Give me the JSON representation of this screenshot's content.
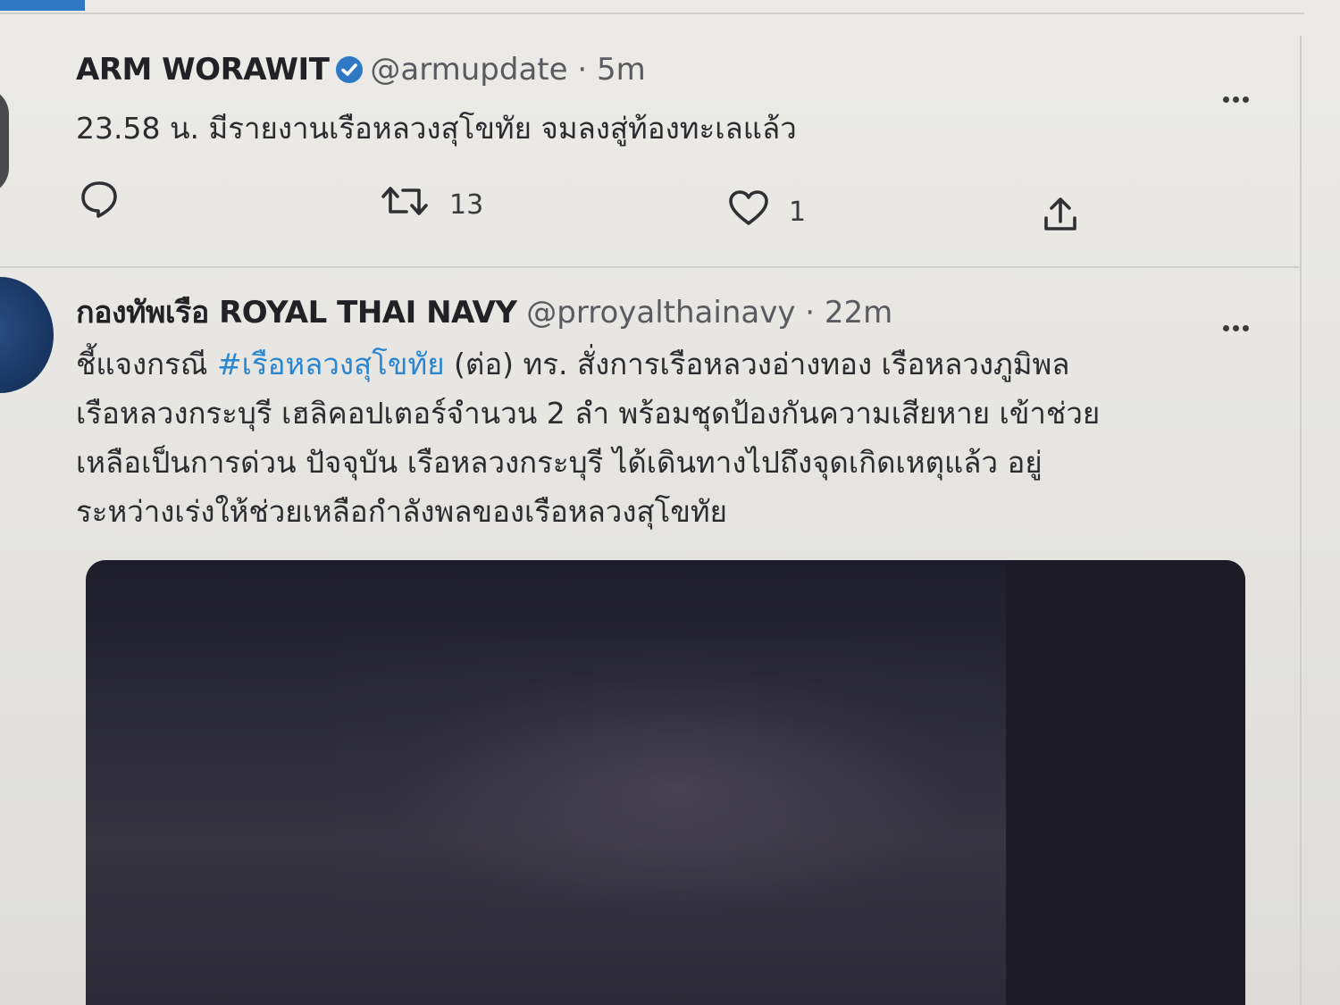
{
  "tweets": [
    {
      "author_name": "ARM WORAWIT",
      "handle": "@armupdate",
      "separator": "·",
      "time": "5m",
      "verified": true,
      "text_lines": [
        "23.58 น. มีรายงานเรือหลวงสุโขทัย จมลงสู่ท้องทะเลแล้ว"
      ],
      "reply_count": "",
      "retweet_count": "13",
      "like_count": "1"
    },
    {
      "author_name": "กองทัพเรือ ROYAL THAI NAVY",
      "handle": "@prroyalthainavy",
      "separator": "·",
      "time": "22m",
      "text_line1_prefix": "ชี้แจงกรณี ",
      "hashtag": "#เรือหลวงสุโขทัย",
      "text_line1_suffix": " (ต่อ) ทร. สั่งการเรือหลวงอ่างทอง เรือหลวงภูมิพล",
      "text_line2": "เรือหลวงกระบุรี เฮลิคอปเตอร์จำนวน 2 ลำ พร้อมชุดป้องกันความเสียหาย เข้าช่วย",
      "text_line3": "เหลือเป็นการด่วน ปัจจุบัน เรือหลวงกระบุรี ได้เดินทางไปถึงจุดเกิดเหตุแล้ว อยู่",
      "text_line4": "ระหว่างเร่งให้ช่วยเหลือกำลังพลของเรือหลวงสุโขทัย"
    }
  ],
  "colors": {
    "accent": "#2f78c4",
    "hashtag": "#2a86d0",
    "verified": "#2f78c4"
  },
  "icons": [
    "reply-icon",
    "retweet-icon",
    "like-icon",
    "share-icon",
    "more-icon",
    "verified-badge-icon"
  ]
}
